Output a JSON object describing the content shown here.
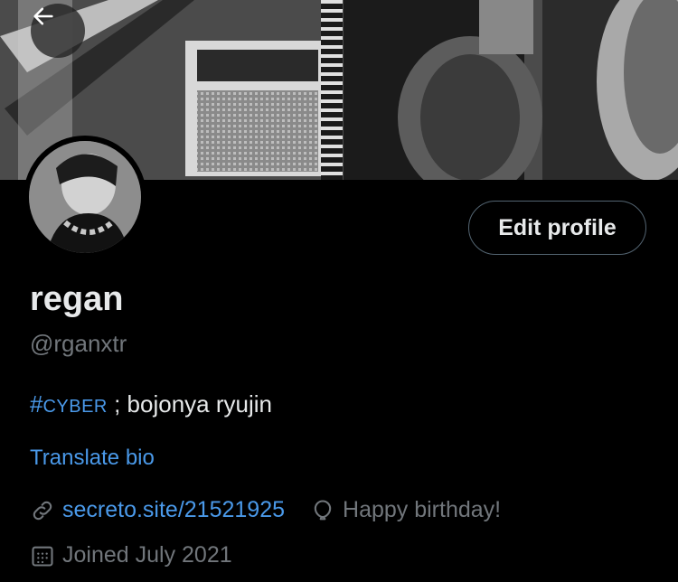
{
  "header": {
    "back_icon": "arrow-left-icon",
    "banner": "profile-banner"
  },
  "profile": {
    "name": "regan",
    "handle": "@rganxtr",
    "bio_hashtag_prefix": "#",
    "bio_hashtag_word": "CYBER",
    "bio_text": " ; bojonya ryujin",
    "translate_label": "Translate bio",
    "website": "secreto.site/21521925",
    "birthday": "Happy birthday!",
    "joined": "Joined July 2021"
  },
  "actions": {
    "edit_profile_label": "Edit profile"
  },
  "colors": {
    "background": "#000000",
    "link": "#4a99e9",
    "secondary_text": "#71767b",
    "primary_text": "#e7e9ea",
    "button_border": "#536471"
  },
  "icons": {
    "website": "link-icon",
    "birthday": "balloon-icon",
    "joined": "calendar-icon"
  }
}
